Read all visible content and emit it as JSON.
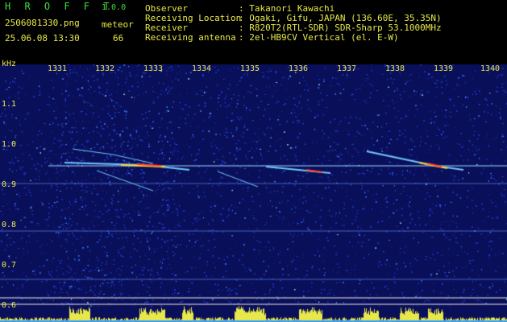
{
  "header": {
    "app_title": "H R O F F T",
    "app_version": "1.0.0",
    "file_name": "2506081330.png",
    "mode_label": "meteor",
    "date_time": "25.06.08 13:30",
    "count_value": "66",
    "info": [
      {
        "key": "Observer",
        "value": ": Takanori Kawachi"
      },
      {
        "key": "Receiving Location",
        "value": ": Ogaki, Gifu, JAPAN (136.60E, 35.35N)"
      },
      {
        "key": "Receiver",
        "value": ": R820T2(RTL-SDR) SDR-Sharp 53.1000MHz"
      },
      {
        "key": "Receiving antenna",
        "value": ": 2el-HB9CV Vertical (el. E-W)"
      }
    ]
  },
  "spectrogram": {
    "y_unit": "kHz",
    "x_ticks": [
      "1331",
      "1332",
      "1333",
      "1334",
      "1335",
      "1336",
      "1337",
      "1338",
      "1339",
      "1340"
    ],
    "y_ticks": [
      "1.1",
      "1.0",
      "0.9",
      "0.8",
      "0.7",
      "0.6"
    ],
    "colors": {
      "background": "#0a0f5a",
      "noise": "#2a5aff",
      "carrier": "#9ad8ff",
      "trail_hot": "#ff4030",
      "trail_warm": "#ffd030",
      "baseline": "#e8e84a"
    }
  }
}
